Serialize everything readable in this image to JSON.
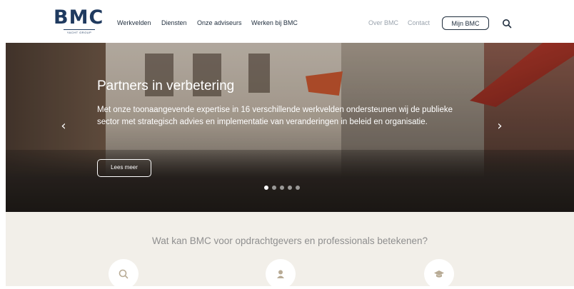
{
  "header": {
    "logo": {
      "main": "BMC",
      "sub": "YACHT GROUP"
    },
    "nav_left": [
      "Werkvelden",
      "Diensten",
      "Onze adviseurs",
      "Werken bij BMC"
    ],
    "nav_right": [
      "Over BMC",
      "Contact"
    ],
    "account_button": "Mijn BMC",
    "search_icon": "search-icon"
  },
  "hero": {
    "title": "Partners in verbetering",
    "text": "Met onze toonaangevende expertise in 16 verschillende werkvelden ondersteunen wij de publieke sector met strategisch advies en implementatie van veranderingen in beleid en organisatie.",
    "button": "Lees meer",
    "prev_icon": "chevron-left-icon",
    "next_icon": "chevron-right-icon",
    "slide_count": 5,
    "active_slide": 1
  },
  "section": {
    "title": "Wat kan BMC voor opdrachtgevers en professionals betekenen?",
    "icons": [
      "search-icon",
      "person-icon",
      "graduation-cap-icon"
    ]
  },
  "colors": {
    "brand": "#1f3a5f",
    "section_bg": "#f2efe9",
    "nav_muted": "#9aa3ad"
  }
}
